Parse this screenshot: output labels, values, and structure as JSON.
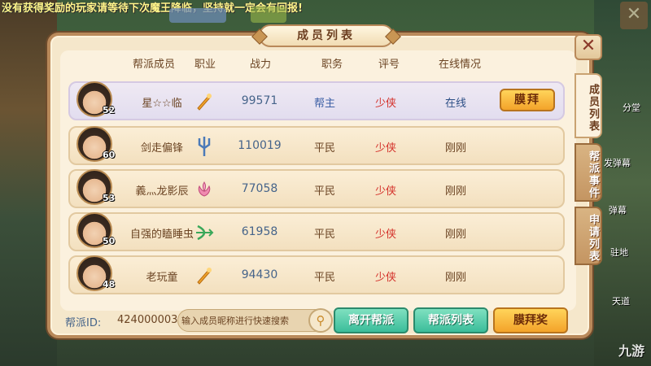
{
  "marquee": "没有获得奖励的玩家请等待下次魔王降临，坚持就一定会有回报!",
  "panel": {
    "title": "成员列表",
    "close": "✕"
  },
  "tabs": [
    {
      "label": "成员列表",
      "active": true
    },
    {
      "label": "帮派事件",
      "active": false
    },
    {
      "label": "申请列表",
      "active": false
    }
  ],
  "headers": {
    "member": "帮派成员",
    "job": "职业",
    "power": "战力",
    "position": "职务",
    "title": "评号",
    "status": "在线情况"
  },
  "members": [
    {
      "name": "星☆☆临",
      "level": "52",
      "job_icon": "feather-fan-icon",
      "power": "99571",
      "position": "帮主",
      "title": "少侠",
      "status": "在线",
      "worship": "膜拜"
    },
    {
      "name": "剑走偏锋",
      "level": "60",
      "job_icon": "trident-icon",
      "power": "110019",
      "position": "平民",
      "title": "少侠",
      "status": "刚刚"
    },
    {
      "name": "義灬龙影辰",
      "level": "53",
      "job_icon": "lotus-icon",
      "power": "77058",
      "position": "平民",
      "title": "少侠",
      "status": "刚刚"
    },
    {
      "name": "自强的瞌睡虫",
      "level": "50",
      "job_icon": "bow-icon",
      "power": "61958",
      "position": "平民",
      "title": "少侠",
      "status": "刚刚"
    },
    {
      "name": "老玩童",
      "level": "48",
      "job_icon": "feather-fan-icon",
      "power": "94430",
      "position": "平民",
      "title": "少侠",
      "status": "刚刚"
    }
  ],
  "footer": {
    "id_label": "帮派ID:",
    "id_value": "424000003",
    "search_placeholder": "输入成员昵称进行快速搜索",
    "buttons": {
      "leave": "离开帮派",
      "list": "帮派列表",
      "worship": "膜拜奖"
    }
  },
  "side_labels": {
    "right1": "分堂",
    "right2": "发弹幕",
    "right3": "弹幕",
    "right4": "驻地",
    "right5": "天道"
  },
  "watermark": "九游"
}
